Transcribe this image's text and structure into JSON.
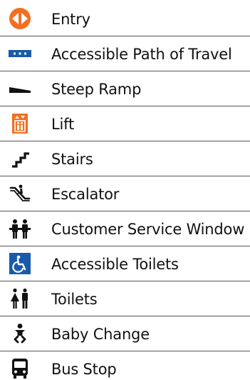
{
  "legend": {
    "items": [
      {
        "label": "Entry",
        "icon": "entry-icon"
      },
      {
        "label": "Accessible Path of Travel",
        "icon": "accessible-path-icon"
      },
      {
        "label": "Steep Ramp",
        "icon": "steep-ramp-icon"
      },
      {
        "label": "Lift",
        "icon": "lift-icon"
      },
      {
        "label": "Stairs",
        "icon": "stairs-icon"
      },
      {
        "label": "Escalator",
        "icon": "escalator-icon"
      },
      {
        "label": "Customer Service Window",
        "icon": "customer-service-icon"
      },
      {
        "label": "Accessible Toilets",
        "icon": "accessible-toilet-icon"
      },
      {
        "label": "Toilets",
        "icon": "toilets-icon"
      },
      {
        "label": "Baby Change",
        "icon": "baby-change-icon"
      },
      {
        "label": "Bus Stop",
        "icon": "bus-stop-icon"
      }
    ]
  },
  "colors": {
    "orange": "#f26f21",
    "blue": "#1a5aa8",
    "black": "#111111",
    "divider": "#555555"
  }
}
